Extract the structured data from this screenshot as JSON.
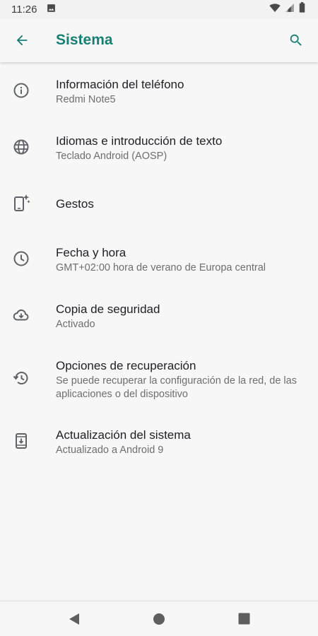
{
  "status_bar": {
    "time": "11:26",
    "icons": [
      "image-icon",
      "wifi-icon",
      "signal-icon",
      "battery-icon"
    ]
  },
  "app_bar": {
    "title": "Sistema",
    "accent_color": "#1a7f73",
    "back_icon": "arrow-back-icon",
    "search_icon": "search-icon"
  },
  "items": [
    {
      "icon": "info-icon",
      "title": "Información del teléfono",
      "subtitle": "Redmi Note5"
    },
    {
      "icon": "globe-icon",
      "title": "Idiomas e introducción de texto",
      "subtitle": "Teclado Android (AOSP)"
    },
    {
      "icon": "gestures-icon",
      "title": "Gestos",
      "subtitle": ""
    },
    {
      "icon": "clock-icon",
      "title": "Fecha y hora",
      "subtitle": "GMT+02:00 hora de verano de Europa central"
    },
    {
      "icon": "cloud-upload-icon",
      "title": "Copia de seguridad",
      "subtitle": "Activado"
    },
    {
      "icon": "history-icon",
      "title": "Opciones de recuperación",
      "subtitle": "Se puede recuperar la configuración de la red, de las aplicaciones o del dispositivo"
    },
    {
      "icon": "system-update-icon",
      "title": "Actualización del sistema",
      "subtitle": "Actualizado a Android 9"
    }
  ],
  "nav_bar": {
    "icons": [
      "back-triangle-icon",
      "home-circle-icon",
      "recents-square-icon"
    ]
  }
}
